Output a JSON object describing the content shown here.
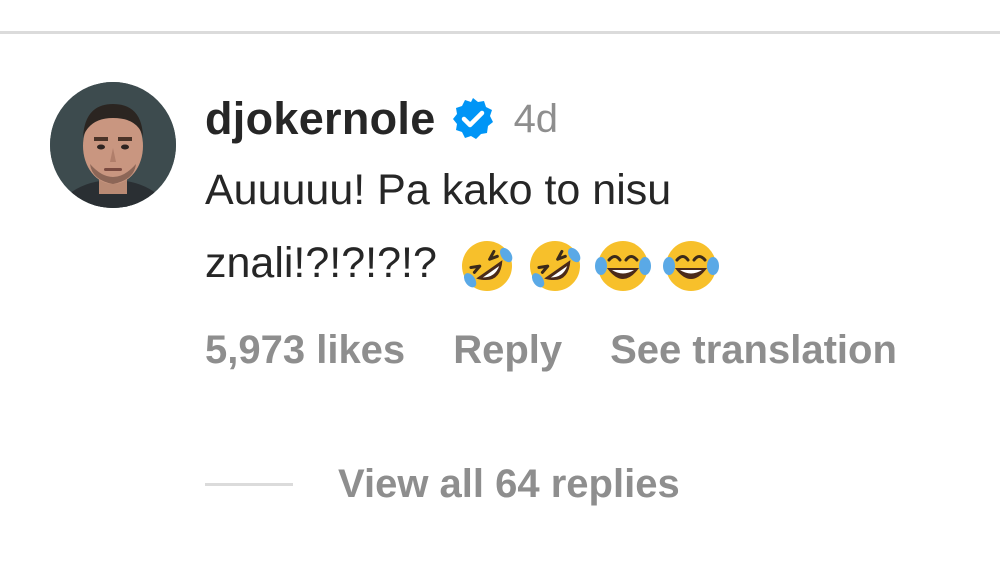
{
  "comment": {
    "username": "djokernole",
    "verified_icon": "verified-badge-icon",
    "timestamp": "4d",
    "text": "Auuuuu! Pa kako to nisu znali!?!?!?!?",
    "emojis": [
      "rolling-on-floor-laughing",
      "rolling-on-floor-laughing",
      "face-with-tears-of-joy",
      "face-with-tears-of-joy"
    ],
    "avatar_icon": "avatar-icon"
  },
  "actions": {
    "likes": "5,973 likes",
    "reply": "Reply",
    "see_translation": "See translation"
  },
  "replies": {
    "label": "View all 64 replies"
  },
  "colors": {
    "primary_text": "#262626",
    "secondary_text": "#8e8e8e",
    "divider": "#dbdbdb",
    "verified_blue": "#0095f6"
  }
}
